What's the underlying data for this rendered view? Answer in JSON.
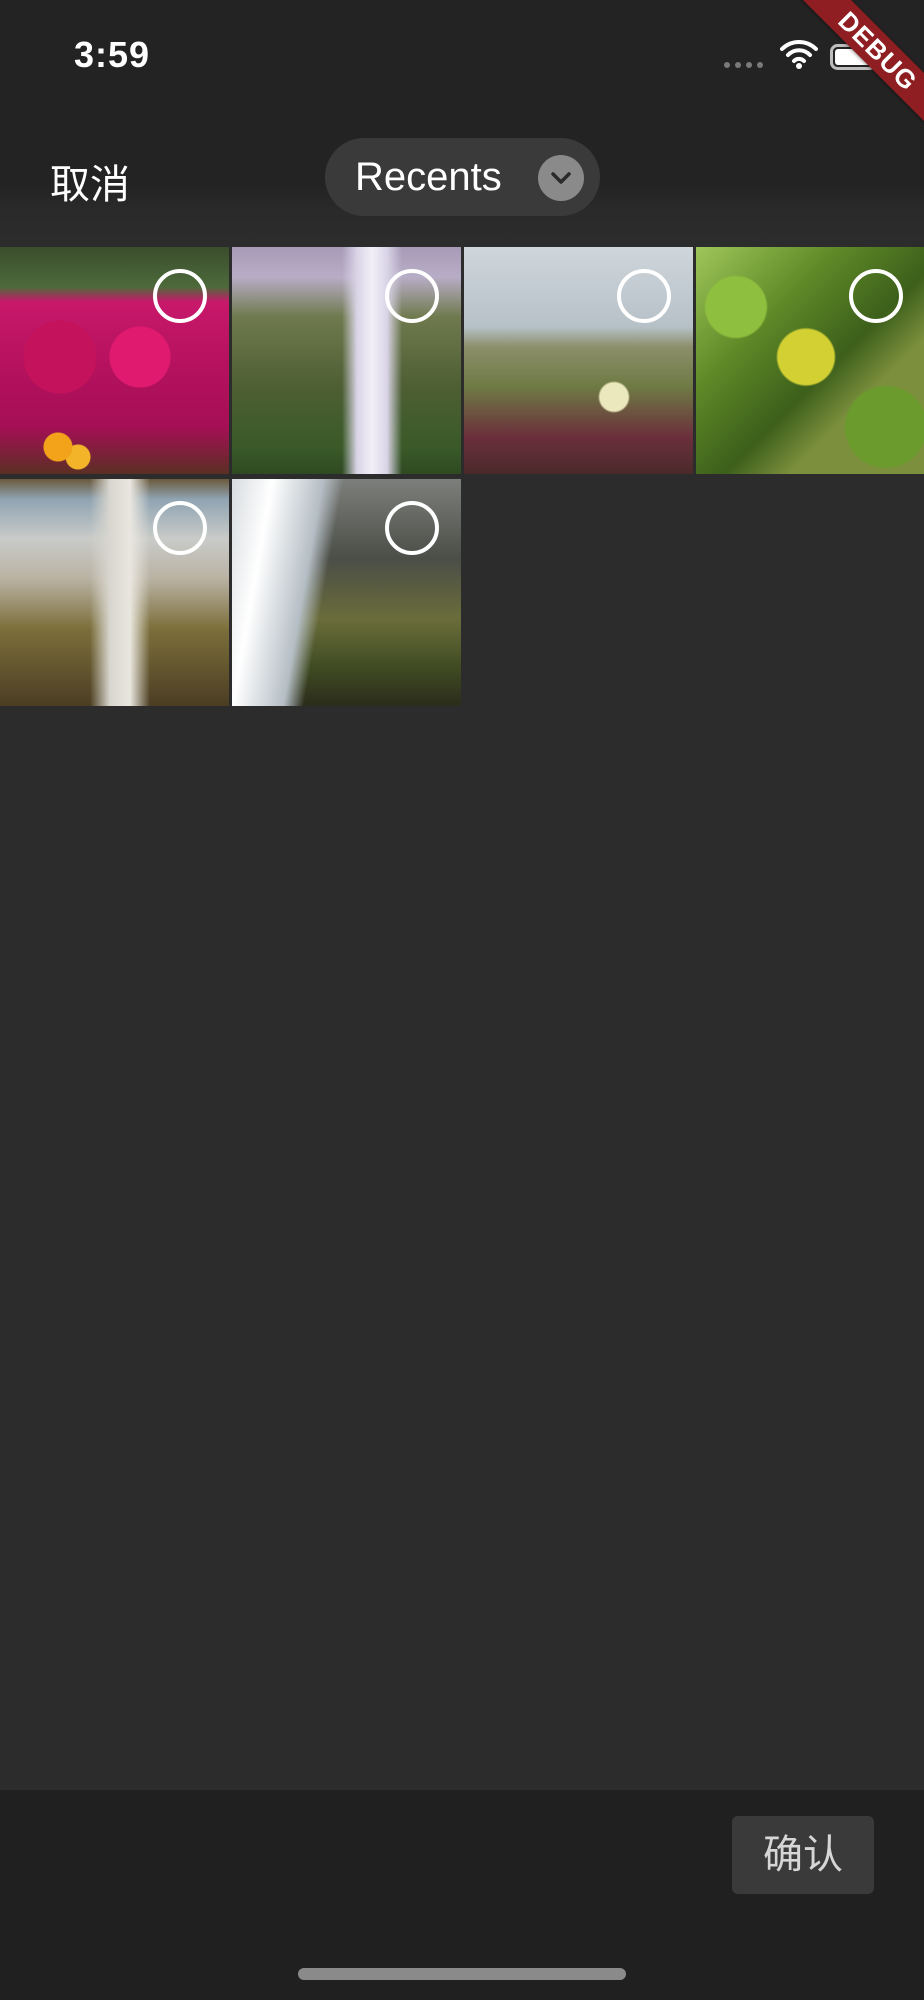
{
  "status_bar": {
    "time": "3:59",
    "icons": [
      "signal-dots-icon",
      "wifi-icon",
      "battery-icon"
    ]
  },
  "debug_banner": {
    "label": "DEBUG",
    "color": "#8f1e22"
  },
  "nav": {
    "cancel_label": "取消",
    "album_label": "Recents",
    "album_icon": "chevron-down-icon"
  },
  "photos": [
    {
      "subject": "magenta flowers",
      "selected": false
    },
    {
      "subject": "waterfall over green cliff",
      "selected": false
    },
    {
      "subject": "grass with white flower",
      "selected": false
    },
    {
      "subject": "green leaves",
      "selected": false
    },
    {
      "subject": "coastal waterfall",
      "selected": false
    },
    {
      "subject": "cascading waterfall over mossy rocks",
      "selected": false
    }
  ],
  "bottom_bar": {
    "confirm_label": "确认"
  },
  "colors": {
    "background": "#2c2c2c",
    "header": "#232323",
    "bottom_bar": "#202020",
    "pill": "#3a3a3a",
    "button": "#3a3a3a"
  }
}
